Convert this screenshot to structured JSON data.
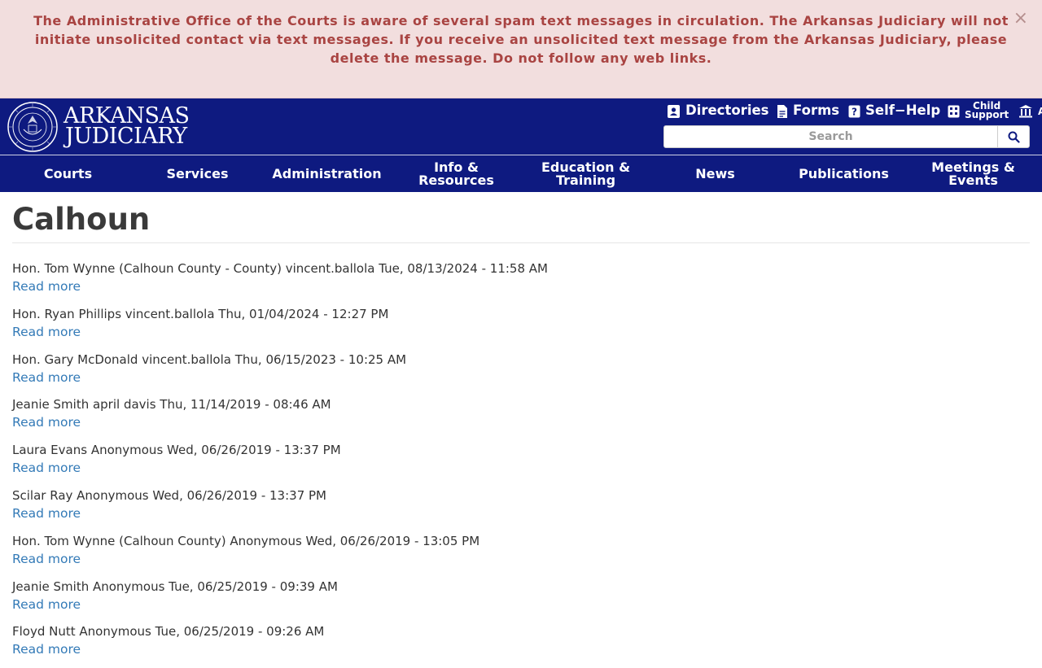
{
  "alert": {
    "message": "The Administrative Office of the Courts is aware of several spam text messages in circulation.  The Arkansas Judiciary will not initiate unsolicited contact via text messages. If you receive an unsolicited text message from the Arkansas Judiciary, please delete the message. Do not follow any web links.",
    "close_glyph": "×"
  },
  "brand": {
    "line1": "ARKANSAS",
    "line2": "JUDICIARY"
  },
  "utility_nav": [
    {
      "label": "Directories",
      "icon": "directory-icon"
    },
    {
      "label": "Forms",
      "icon": "document-icon"
    },
    {
      "label": "Self−Help",
      "icon": "question-icon"
    },
    {
      "label_line1": "Child",
      "label_line2": "Support",
      "icon": "calculator-icon"
    },
    {
      "label": "A",
      "icon": "courthouse-icon"
    }
  ],
  "search": {
    "placeholder": "Search"
  },
  "main_nav": [
    {
      "label": "Courts"
    },
    {
      "label": "Services"
    },
    {
      "label": "Administration"
    },
    {
      "label_line1": "Info &",
      "label_line2": "Resources"
    },
    {
      "label_line1": "Education &",
      "label_line2": "Training"
    },
    {
      "label": "News"
    },
    {
      "label": "Publications"
    },
    {
      "label_line1": "Meetings &",
      "label_line2": "Events"
    }
  ],
  "page": {
    "title": "Calhoun"
  },
  "entries": [
    {
      "text": "Hon. Tom Wynne (Calhoun County - County) vincent.ballola Tue, 08/13/2024 - 11:58 AM",
      "link": "Read more"
    },
    {
      "text": "Hon. Ryan Phillips vincent.ballola Thu, 01/04/2024 - 12:27 PM",
      "link": "Read more"
    },
    {
      "text": "Hon. Gary McDonald vincent.ballola Thu, 06/15/2023 - 10:25 AM",
      "link": "Read more"
    },
    {
      "text": "Jeanie Smith april davis Thu, 11/14/2019 - 08:46 AM",
      "link": "Read more"
    },
    {
      "text": "Laura Evans Anonymous Wed, 06/26/2019 - 13:37 PM",
      "link": "Read more"
    },
    {
      "text": "Scilar Ray Anonymous Wed, 06/26/2019 - 13:37 PM",
      "link": "Read more"
    },
    {
      "text": "Hon. Tom Wynne (Calhoun County) Anonymous Wed, 06/26/2019 - 13:05 PM",
      "link": "Read more"
    },
    {
      "text": "Jeanie Smith Anonymous Tue, 06/25/2019 - 09:39 AM",
      "link": "Read more"
    },
    {
      "text": "Floyd Nutt Anonymous Tue, 06/25/2019 - 09:26 AM",
      "link": "Read more"
    }
  ],
  "colors": {
    "header_bg": "#0e1a80",
    "alert_bg": "#f2dede",
    "alert_text": "#a94442",
    "link": "#337ab7"
  }
}
